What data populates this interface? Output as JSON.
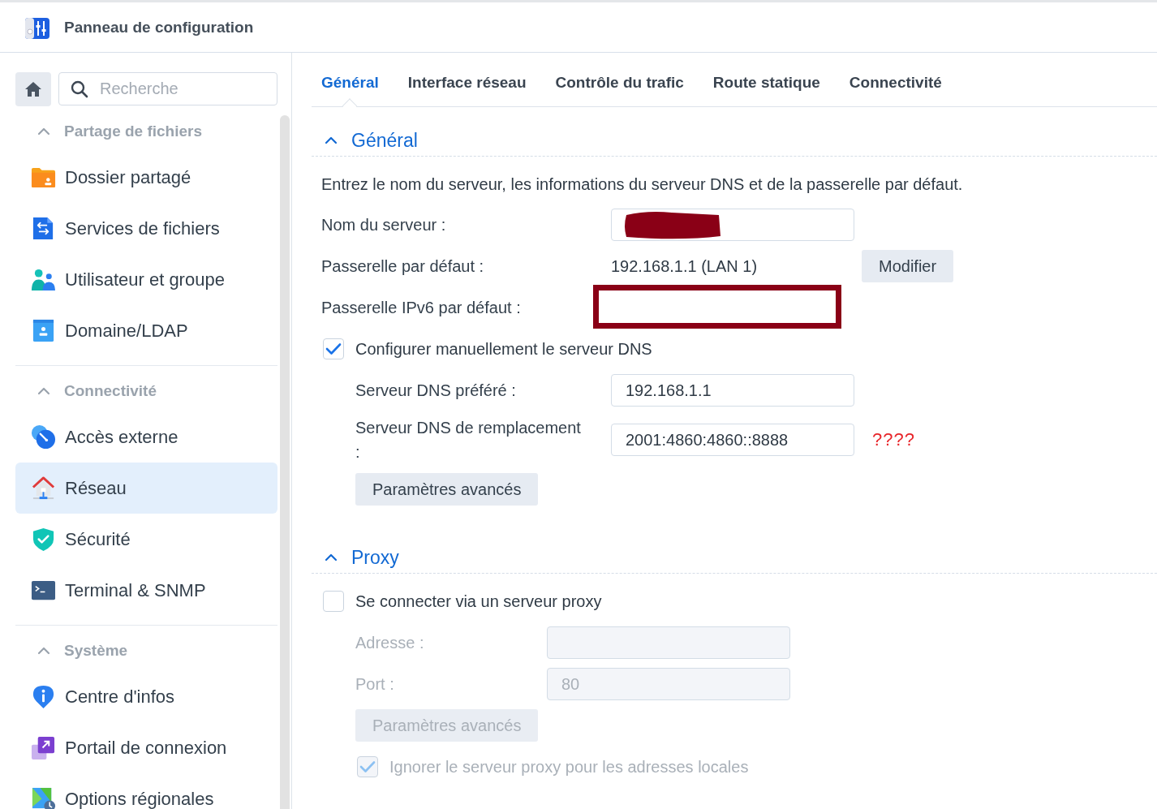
{
  "window": {
    "title": "Panneau de configuration"
  },
  "sidebar": {
    "search": {
      "placeholder": "Recherche"
    },
    "groups": [
      {
        "title": "Partage de fichiers",
        "expanded": true,
        "items": [
          {
            "label": "Dossier partagé",
            "selected": false
          },
          {
            "label": "Services de fichiers",
            "selected": false
          },
          {
            "label": "Utilisateur et groupe",
            "selected": false
          },
          {
            "label": "Domaine/LDAP",
            "selected": false
          }
        ]
      },
      {
        "title": "Connectivité",
        "expanded": true,
        "items": [
          {
            "label": "Accès externe",
            "selected": false
          },
          {
            "label": "Réseau",
            "selected": true
          },
          {
            "label": "Sécurité",
            "selected": false
          },
          {
            "label": "Terminal & SNMP",
            "selected": false
          }
        ]
      },
      {
        "title": "Système",
        "expanded": true,
        "items": [
          {
            "label": "Centre d'infos",
            "selected": false
          },
          {
            "label": "Portail de connexion",
            "selected": false
          },
          {
            "label": "Options régionales",
            "selected": false
          }
        ]
      }
    ]
  },
  "tabs": [
    {
      "label": "Général",
      "selected": true
    },
    {
      "label": "Interface réseau",
      "selected": false
    },
    {
      "label": "Contrôle du trafic",
      "selected": false
    },
    {
      "label": "Route statique",
      "selected": false
    },
    {
      "label": "Connectivité",
      "selected": false
    }
  ],
  "sections": [
    {
      "title": "Général",
      "expanded": true,
      "description": "Entrez le nom du serveur, les informations du serveur DNS et de la passerelle par défaut.",
      "rows": [
        {
          "kind": "field",
          "label": "Nom du serveur :",
          "redacted": true,
          "disabled": false
        },
        {
          "kind": "value",
          "label": "Passerelle par défaut :",
          "value": "192.168.1.1 (LAN 1)",
          "button": "Modifier"
        },
        {
          "kind": "highlight",
          "label": "Passerelle IPv6 par défaut :"
        },
        {
          "kind": "checkbox",
          "label": "Configurer manuellement le serveur DNS",
          "checked": true,
          "disabled": false,
          "children": [
            {
              "kind": "field",
              "label": "Serveur DNS préféré :",
              "value": "192.168.1.1",
              "disabled": false
            },
            {
              "kind": "field",
              "label": "Serveur DNS de remplacement :",
              "value": "2001:4860:4860::8888",
              "annotation": "????",
              "disabled": false
            },
            {
              "kind": "button",
              "label": "Paramètres avancés",
              "disabled": false
            }
          ]
        }
      ]
    },
    {
      "title": "Proxy",
      "expanded": true,
      "rows": [
        {
          "kind": "checkbox",
          "label": "Se connecter via un serveur proxy",
          "checked": false,
          "disabled": false,
          "children": [
            {
              "kind": "field",
              "label": "Adresse :",
              "disabled": true
            },
            {
              "kind": "field",
              "label": "Port :",
              "value": "80",
              "disabled": true
            },
            {
              "kind": "button",
              "label": "Paramètres avancés",
              "disabled": true
            },
            {
              "kind": "checkbox",
              "label": "Ignorer le serveur proxy pour les adresses locales",
              "checked": true,
              "disabled": true
            }
          ]
        }
      ]
    }
  ]
}
